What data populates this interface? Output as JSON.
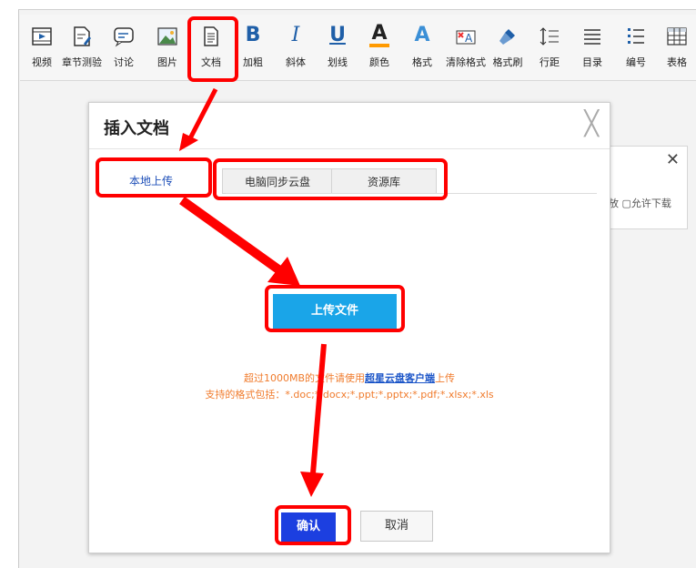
{
  "toolbar": {
    "items": [
      {
        "label": "视频",
        "icon": "video-icon"
      },
      {
        "label": "章节测验",
        "icon": "quiz-icon"
      },
      {
        "label": "讨论",
        "icon": "discussion-icon"
      },
      {
        "label": "图片",
        "icon": "image-icon"
      },
      {
        "label": "文档",
        "icon": "document-icon"
      },
      {
        "label": "加粗",
        "glyph": "B"
      },
      {
        "label": "斜体",
        "glyph": "I"
      },
      {
        "label": "划线",
        "glyph": "U"
      },
      {
        "label": "颜色",
        "glyph": "A"
      },
      {
        "label": "格式",
        "glyph": "A"
      },
      {
        "label": "清除格式",
        "icon": "clear-format-icon"
      },
      {
        "label": "格式刷",
        "icon": "format-brush-icon"
      },
      {
        "label": "行距",
        "icon": "line-spacing-icon"
      },
      {
        "label": "目录",
        "icon": "toc-icon"
      },
      {
        "label": "编号",
        "icon": "numbering-icon"
      },
      {
        "label": "表格",
        "icon": "table-icon"
      }
    ]
  },
  "background_panel": {
    "close": "✕",
    "option_text": "放 ▢允许下载"
  },
  "dialog": {
    "title": "插入文档",
    "close": "╳",
    "tabs": [
      "本地上传",
      "电脑同步云盘",
      "资源库"
    ],
    "upload_button": "上传文件",
    "note_line1_prefix": "超过1000MB的文件请使用",
    "note_line1_link": "超星云盘客户端",
    "note_line1_suffix": "上传",
    "note_line2": "支持的格式包括：*.doc;*.docx;*.ppt;*.pptx;*.pdf;*.xlsx;*.xls",
    "confirm": "确认",
    "cancel": "取消"
  },
  "colors": {
    "annotation": "#ff0000",
    "upload": "#1aa5e8",
    "confirm": "#1c3fe0",
    "note": "#f07b2c"
  }
}
